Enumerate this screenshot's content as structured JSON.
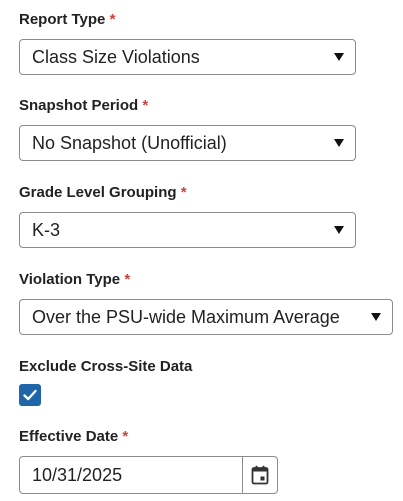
{
  "report_type": {
    "label": "Report Type",
    "required_marker": "*",
    "value": "Class Size Violations"
  },
  "snapshot_period": {
    "label": "Snapshot Period",
    "required_marker": "*",
    "value": "No Snapshot (Unofficial)"
  },
  "grade_level_grouping": {
    "label": "Grade Level Grouping",
    "required_marker": "*",
    "value": "K-3"
  },
  "violation_type": {
    "label": "Violation Type",
    "required_marker": "*",
    "value": "Over the PSU-wide Maximum Average"
  },
  "exclude_cross_site": {
    "label": "Exclude Cross-Site Data",
    "checked": true
  },
  "effective_date": {
    "label": "Effective Date",
    "required_marker": "*",
    "value": "10/31/2025"
  },
  "colors": {
    "required": "#d43f3a",
    "checkbox_fill": "#1f66a8",
    "border": "#8c8c8c"
  },
  "icons": {
    "select_caret": "caret-down-icon",
    "checkbox": "checkmark-icon",
    "calendar": "calendar-icon"
  }
}
